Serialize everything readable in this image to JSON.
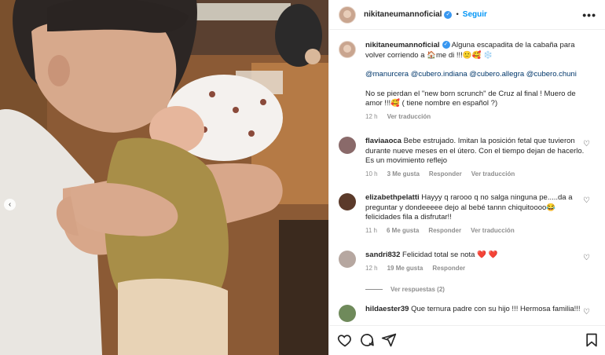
{
  "post": {
    "username": "nikitaneumannoficial",
    "follow_label": "Seguir",
    "separator": "•",
    "more_label": "•••",
    "caption": {
      "line1": "Alguna escapadita de la cabaña para volver corriendo a 🏠me di !!!🙂🥰 ❄️",
      "mentions": "@manurcera @cubero.indiana @cubero.allegra @cubero.chuni",
      "text2": "No se pierdan el \"new born scrunch\" de Cruz al final ! Muero de amor !!!🥰 ( tiene nombre en español ?)",
      "time": "12 h",
      "translate": "Ver traducción"
    }
  },
  "comments": [
    {
      "username": "flaviaaoca",
      "text": "Bebe estrujado. Imitan la posición fetal que tuvieron durante nueve meses en el útero. Con el tiempo dejan de hacerlo. Es un movimiento reflejo",
      "time": "10 h",
      "likes": "3 Me gusta",
      "reply": "Responder",
      "translate": "Ver traducción",
      "avatar_color": "#8a6a6a"
    },
    {
      "username": "elizabethpelatti",
      "text": "Hayyy q rarooo q no salga ninguna pe.....da a preguntar y dondeeeee dejo al bebé tannn chiquitoooo😂 felicidades fila a disfrutar!!",
      "time": "11 h",
      "likes": "6 Me gusta",
      "reply": "Responder",
      "translate": "Ver traducción",
      "avatar_color": "#5b3a2a"
    },
    {
      "username": "sandri832",
      "text": "Felicidad total se nota",
      "hearts": "❤️ ❤️",
      "time": "12 h",
      "likes": "19 Me gusta",
      "reply": "Responder",
      "avatar_color": "#b6a7a0"
    },
    {
      "username": "hildaester39",
      "text": "Que ternura padre con su hijo !!! Hermosa familia!!!",
      "avatar_color": "#6f8a5b"
    }
  ],
  "view_replies": "Ver respuestas (2)",
  "icons": {
    "heart": "heart-icon",
    "comment": "comment-icon",
    "share": "share-icon",
    "save": "bookmark-icon",
    "carousel_prev": "chevron-left-icon"
  },
  "colors": {
    "link": "#0095f6",
    "verified": "#3897f0",
    "muted": "#8e8e8e",
    "heart_red": "#ed4956"
  }
}
